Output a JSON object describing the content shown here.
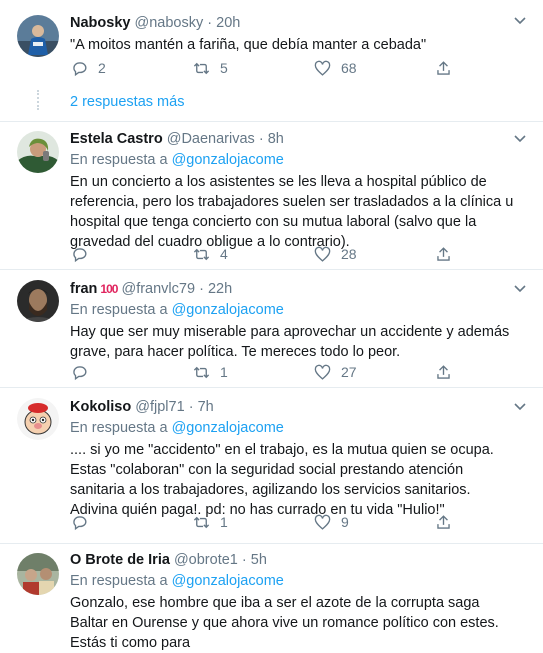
{
  "tweets": [
    {
      "name": "Nabosky",
      "handle": "@nabosky",
      "time": "20h",
      "text": "\"A moitos mantén a fariña, que debía manter a cebada\"",
      "replies": "2",
      "retweets": "5",
      "likes": "68"
    },
    {
      "name": "Estela Castro",
      "handle": "@Daenarivas",
      "time": "8h",
      "reply_prefix": "En respuesta a",
      "reply_to": "@gonzalojacome",
      "text": "En un concierto a los asistentes se les lleva a hospital público de referencia, pero los trabajadores suelen ser trasladados a la clínica u hospital que tenga concierto con su mutua laboral (salvo que la gravedad del cuadro obligue a lo contrario).",
      "replies": "",
      "retweets": "4",
      "likes": "28"
    },
    {
      "name": "fran",
      "name_emoji": "100",
      "handle": "@franvlc79",
      "time": "22h",
      "reply_prefix": "En respuesta a",
      "reply_to": "@gonzalojacome",
      "text": "Hay que ser muy miserable para aprovechar un accidente y además grave, para hacer política. Te mereces todo lo peor.",
      "replies": "",
      "retweets": "1",
      "likes": "27"
    },
    {
      "name": "Kokoliso",
      "handle": "@fjpl71",
      "time": "7h",
      "reply_prefix": "En respuesta a",
      "reply_to": "@gonzalojacome",
      "text": ".... si yo me \"accidento\" en el trabajo, es la mutua quien se ocupa. Estas \"colaboran\" con la seguridad social prestando atención sanitaria a los trabajadores, agilizando los servicios sanitarios. Adivina quién paga!. pd: no has currado en tu vida \"Hulio!\"",
      "replies": "",
      "retweets": "1",
      "likes": "9"
    },
    {
      "name": "O Brote de Iria",
      "handle": "@obrote1",
      "time": "5h",
      "reply_prefix": "En respuesta a",
      "reply_to": "@gonzalojacome",
      "text": "Gonzalo, ese hombre que iba a ser el azote de la corrupta saga Baltar en Ourense y que ahora vive un romance político con estes. Estás ti como para"
    }
  ],
  "more_replies": "2 respuestas más",
  "dot": "·",
  "colors": {
    "accent": "#1da1f2",
    "secondary_text": "#657786",
    "border": "#e6ecf0"
  },
  "icons": {
    "reply": "reply-icon",
    "retweet": "retweet-icon",
    "like": "heart-icon",
    "share": "share-icon",
    "caret": "chevron-down-icon"
  }
}
